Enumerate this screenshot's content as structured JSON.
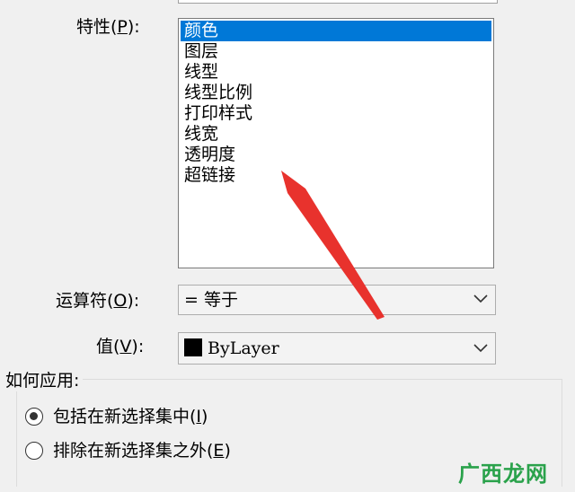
{
  "properties": {
    "label_text": "特性(",
    "label_key": "P",
    "label_end": "):",
    "items": [
      "颜色",
      "图层",
      "线型",
      "线型比例",
      "打印样式",
      "线宽",
      "透明度",
      "超链接"
    ],
    "selected_index": 0
  },
  "operator": {
    "label_text": "运算符(",
    "label_key": "O",
    "label_end": "):",
    "value": "= 等于"
  },
  "value_field": {
    "label_text": "值(",
    "label_key": "V",
    "label_end": "):",
    "value": "ByLayer",
    "swatch_color": "#000000"
  },
  "apply": {
    "title": "如何应用:",
    "include_label": "包括在新选择集中(",
    "include_key": "I",
    "include_end": ")",
    "exclude_label": "排除在新选择集之外(",
    "exclude_key": "E",
    "exclude_end": ")",
    "selected": "include"
  },
  "annotation": {
    "arrow_color": "#e8322d"
  },
  "watermark": "广西龙网",
  "colors": {
    "selection": "#0078d7",
    "watermark": "#2aa24b"
  }
}
